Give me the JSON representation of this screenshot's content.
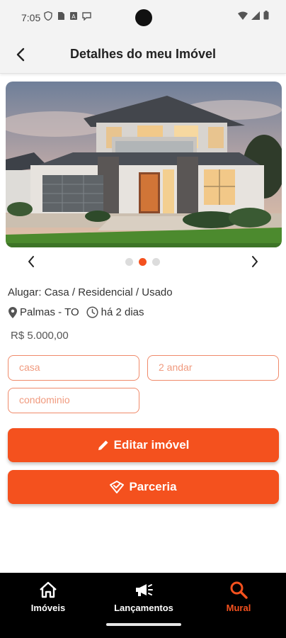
{
  "status_bar": {
    "time": "7:05",
    "icons_left": [
      "shield-icon",
      "sim-icon",
      "a-icon",
      "chat-icon"
    ],
    "icons_right": [
      "wifi-icon",
      "signal-icon",
      "battery-icon"
    ]
  },
  "app_bar": {
    "back_icon": "arrow-back-icon",
    "title": "Detalhes do meu Imóvel"
  },
  "carousel": {
    "image": "house-photo",
    "total_slides": 3,
    "active_slide": 2
  },
  "listing": {
    "category": "Alugar: Casa / Residencial / Usado",
    "location": "Palmas - TO",
    "posted": "há 2 dias",
    "price": "R$ 5.000,00"
  },
  "tags": [
    "casa",
    "2 andar",
    "condominio"
  ],
  "actions": {
    "edit_label": "Editar imóvel",
    "partner_label": "Parceria"
  },
  "bottom_nav": {
    "items": [
      {
        "label": "Imóveis",
        "icon": "home-icon",
        "active": false
      },
      {
        "label": "Lançamentos",
        "icon": "megaphone-icon",
        "active": false
      },
      {
        "label": "Mural",
        "icon": "search-icon",
        "active": true
      }
    ]
  },
  "colors": {
    "accent": "#f4511e",
    "tag_border": "#f08a6a",
    "nav_bg": "#000000",
    "app_bar_bg": "#f3f3f3"
  }
}
